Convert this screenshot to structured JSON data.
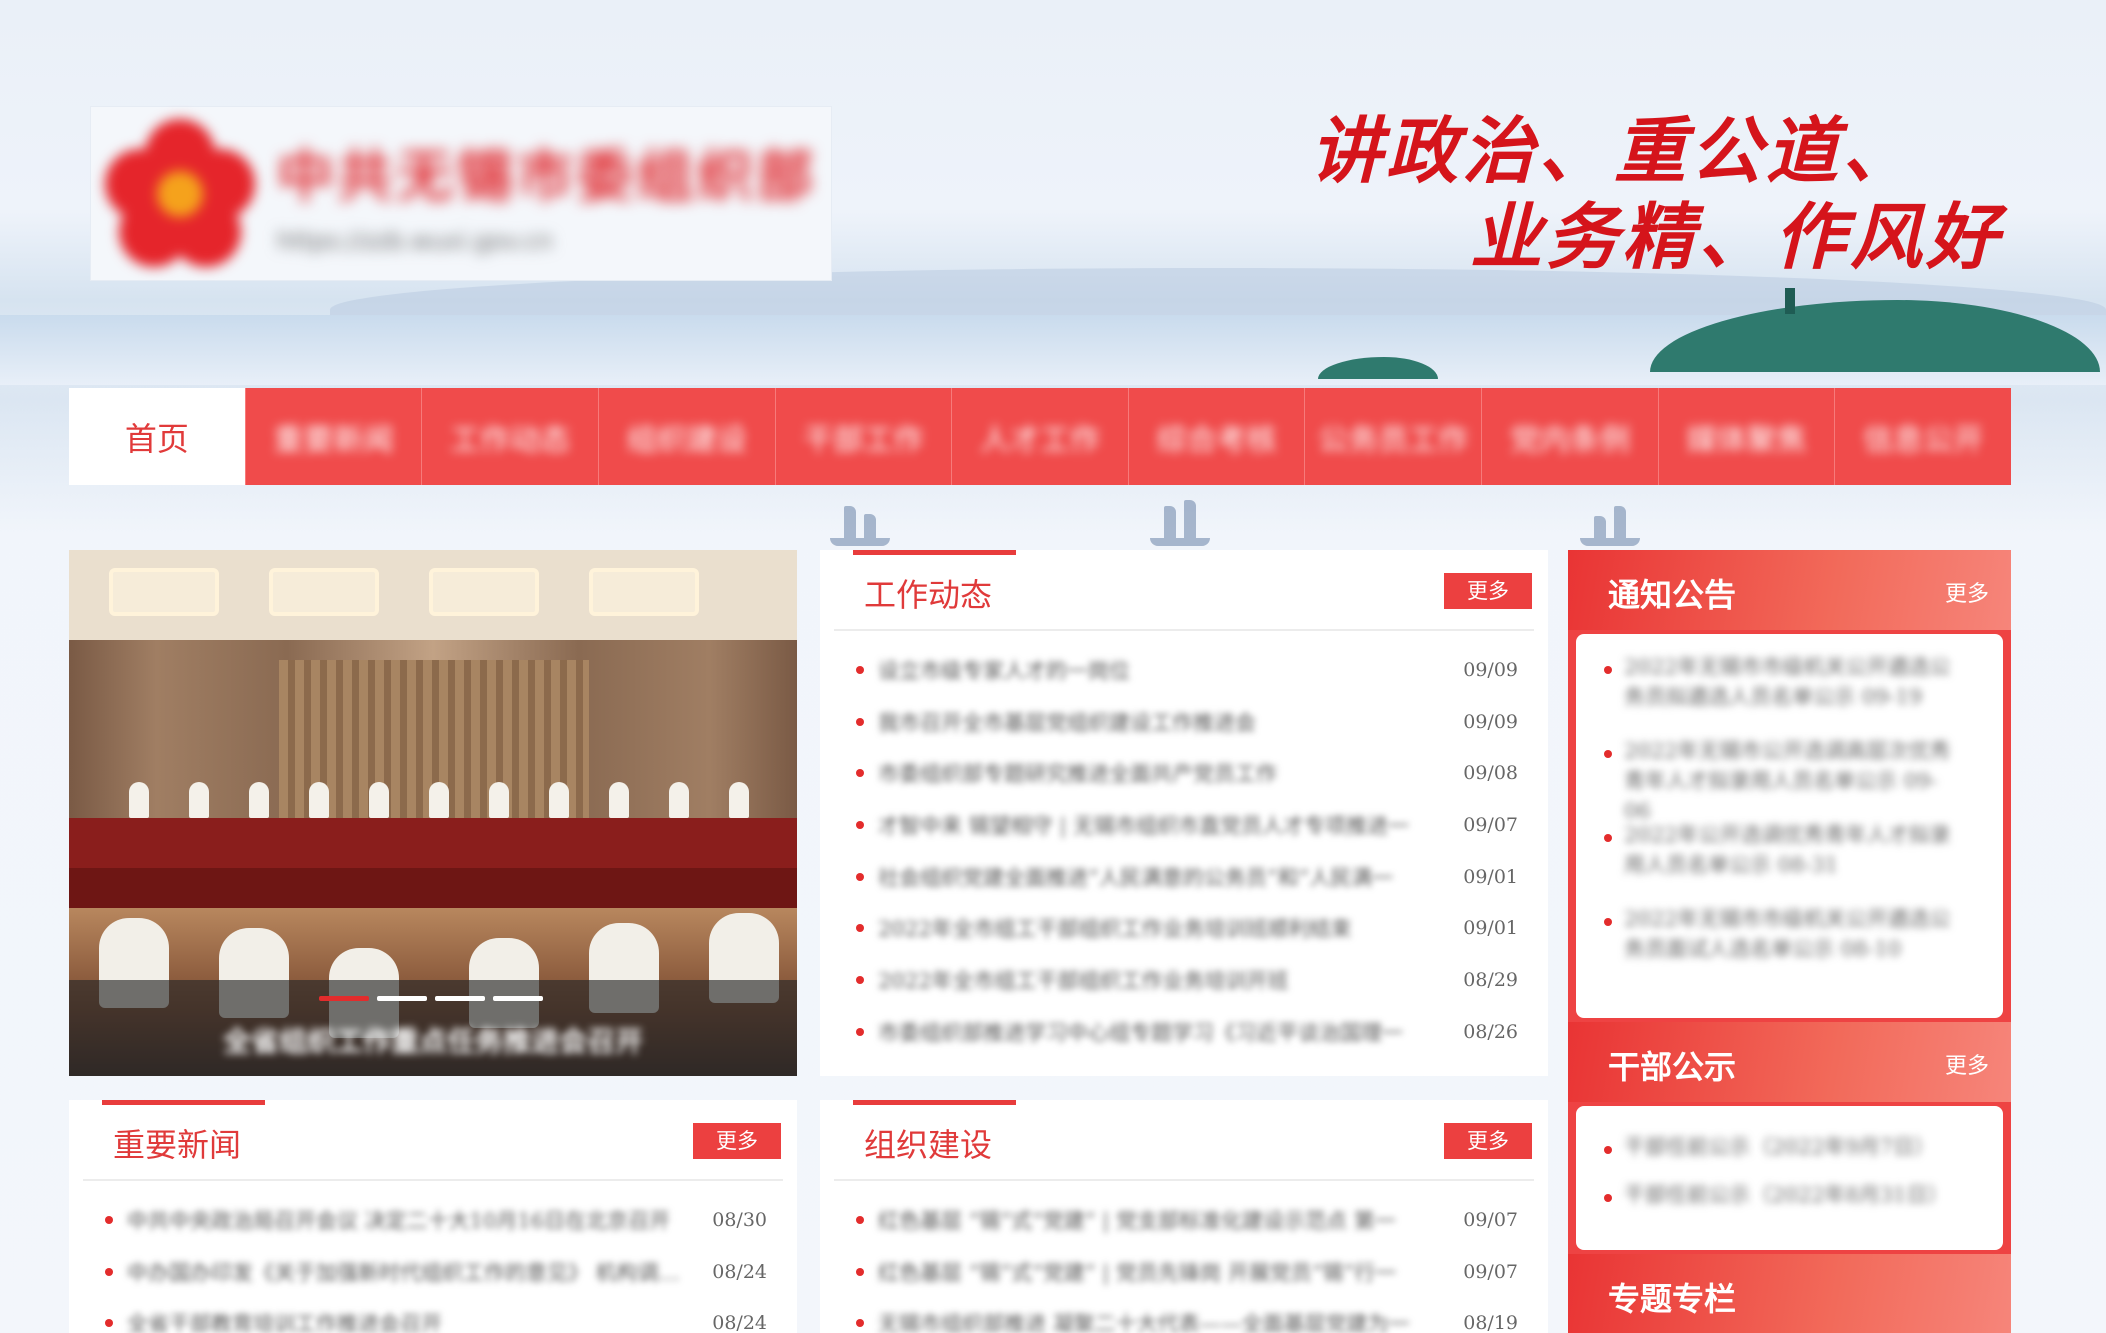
{
  "header": {
    "logo_name": "中共无锡市委组织部",
    "logo_url": "https://zzb.wuxi.gov.cn",
    "slogan_line1": "讲政治、重公道、",
    "slogan_line2": "业务精、作风好"
  },
  "nav": {
    "items": [
      {
        "label": "首页"
      },
      {
        "label": "重要新闻"
      },
      {
        "label": "工作动态"
      },
      {
        "label": "组织建设"
      },
      {
        "label": "干部工作"
      },
      {
        "label": "人才工作"
      },
      {
        "label": "综合考核"
      },
      {
        "label": "公务员工作"
      },
      {
        "label": "党内条例"
      },
      {
        "label": "媒体聚焦"
      },
      {
        "label": "信息公开"
      }
    ]
  },
  "carousel": {
    "caption": "全省组织工作重点任务推进会召开",
    "dots": 4,
    "active_dot": 0
  },
  "work_news": {
    "title": "工作动态",
    "more": "更多",
    "items": [
      {
        "text": "设立市级专家人才的一岗位",
        "date": "09/09"
      },
      {
        "text": "我市召开全市基层党组织建设工作推进会",
        "date": "09/09"
      },
      {
        "text": "市委组织部专题研究推进全面共产党员工作",
        "date": "09/08"
      },
      {
        "text": "才智中来 锡望相守 | 无锡市组织市直党员人才专项推进一",
        "date": "09/07"
      },
      {
        "text": "社会组织党建全面推进“人民满意的公务员”和“人民满一",
        "date": "09/01"
      },
      {
        "text": "2022年全市组工干部组织工作业务培训班顺利结束",
        "date": "09/01"
      },
      {
        "text": "2022年全市组工干部组织工作业务培训开班",
        "date": "08/29"
      },
      {
        "text": "市委组织部推进学习中心组专题学习《习近平谈治国理一",
        "date": "08/26"
      }
    ]
  },
  "notices": {
    "title": "通知公告",
    "more": "更多",
    "items": [
      {
        "text": "2022年无锡市市级机关公开遴选公务员拟遴选人员名单公示",
        "date": "09-19"
      },
      {
        "text": "2022年无锡市公开选调高层次优秀青年人才拟录用人员名单公示",
        "date": "09-06"
      },
      {
        "text": "2022年公开选调优秀青年人才拟录用人员名单公示",
        "date": "08-31"
      },
      {
        "text": "2022年无锡市市级机关公开遴选公务员面试人选名单公示",
        "date": "08-10"
      }
    ]
  },
  "cadre": {
    "title": "干部公示",
    "more": "更多",
    "items": [
      {
        "text": "干部任前公示（2022年9月7日）"
      },
      {
        "text": "干部任前公示（2022年8月31日）"
      }
    ]
  },
  "special": {
    "title": "专题专栏"
  },
  "important_news": {
    "title": "重要新闻",
    "more": "更多",
    "items": [
      {
        "text": "中共中央政治局召开会议 决定二十大10月16日在北京召开",
        "date": "08/30"
      },
      {
        "text": "中办国办印发《关于加强新时代组织工作的意见》 机构调整了一",
        "date": "08/24"
      },
      {
        "text": "全省干部教育培训工作推进会召开",
        "date": "08/24"
      }
    ]
  },
  "org_building": {
    "title": "组织建设",
    "more": "更多",
    "items": [
      {
        "text": "红色基层 “锡”式“党建” | 党支部标准化建设示范点 第一",
        "date": "09/07"
      },
      {
        "text": "红色基层 “锡”式“党建” | 党员先锋岗 开展党员“锡”行一",
        "date": "09/07"
      },
      {
        "text": "无锡市组织部推进 凝聚二十大代表——全面基层党建为一",
        "date": "08/19"
      }
    ]
  },
  "colors": {
    "brand_red": "#f04b4b",
    "title_red": "#e03a3a",
    "accent_red": "#e32c2c"
  }
}
